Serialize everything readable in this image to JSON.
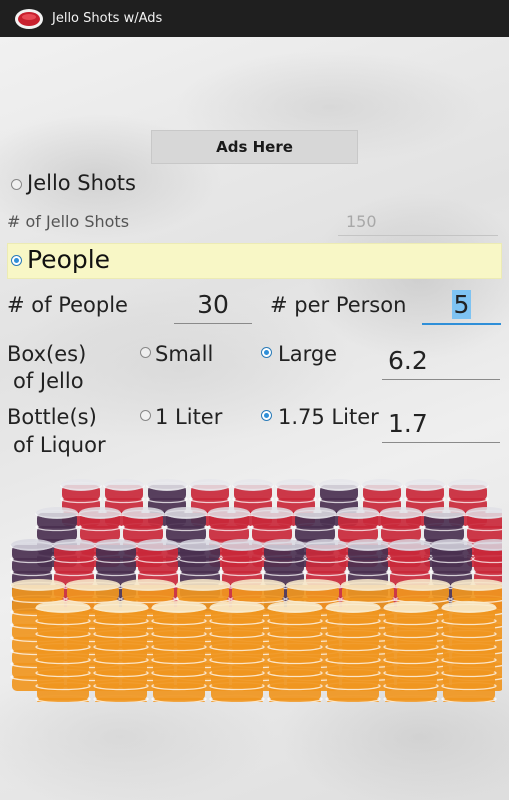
{
  "titlebar": {
    "title": "Jello Shots w/Ads",
    "icon": "jello-logo-icon"
  },
  "ad": {
    "label": "Ads Here"
  },
  "mode_jello": {
    "label": "Jello Shots",
    "selected": false
  },
  "jello_count": {
    "label": "# of Jello Shots",
    "value": "150"
  },
  "mode_people": {
    "label": "People",
    "selected": true
  },
  "people": {
    "label": "# of People",
    "value": "30",
    "per_label": "# per Person",
    "per_value": "5"
  },
  "jello": {
    "label_line1": "Box(es)",
    "label_line2": "of Jello",
    "small_label": "Small",
    "large_label": "Large",
    "selected": "Large",
    "value": "6.2"
  },
  "liquor": {
    "label_line1": "Bottle(s)",
    "label_line2": "of Liquor",
    "option1_label": "1 Liter",
    "option2_label": "1.75 Liter",
    "selected": "1.75 Liter",
    "value": "1.7"
  },
  "image": {
    "name": "jello-shot-cups-image"
  },
  "colors": {
    "accent": "#2f8fd8",
    "highlight": "#f8f7c6",
    "titlebar": "#1f1f1f",
    "cup_orange": "#f0961f",
    "cup_red": "#c9283a",
    "cup_purple": "#4a3050"
  }
}
